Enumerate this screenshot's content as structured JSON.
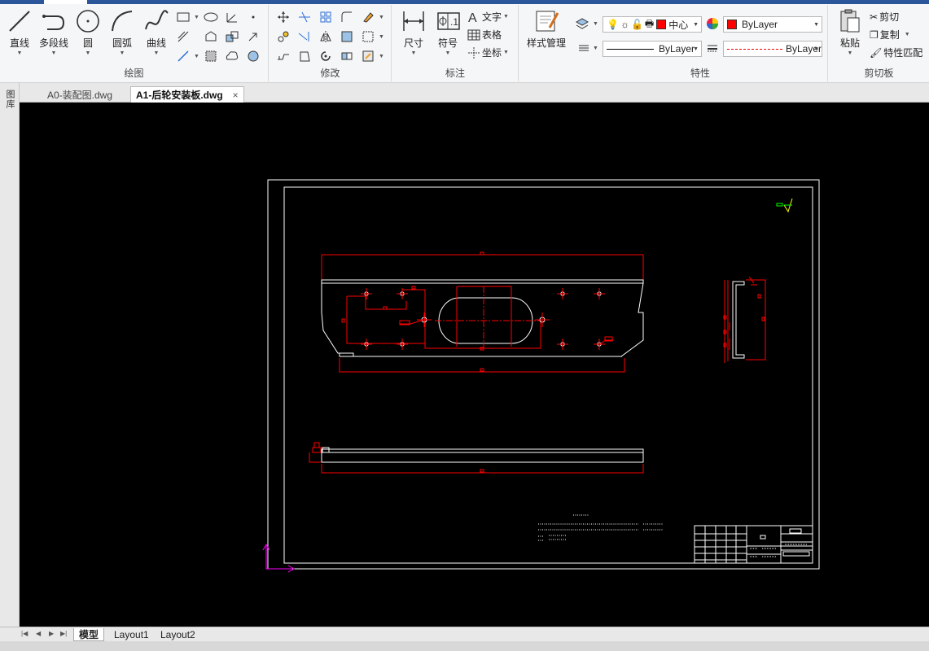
{
  "ribbon": {
    "draw_panel": {
      "title": "绘图",
      "buttons": [
        {
          "label": "直线",
          "icon": "line-icon"
        },
        {
          "label": "多段线",
          "icon": "polyline-icon"
        },
        {
          "label": "圆",
          "icon": "circle-icon"
        },
        {
          "label": "圆弧",
          "icon": "arc-icon"
        },
        {
          "label": "曲线",
          "icon": "spline-icon"
        }
      ]
    },
    "modify_panel": {
      "title": "修改"
    },
    "annotate_panel": {
      "title": "标注",
      "dimension_label": "尺寸",
      "symbol_label": "符号",
      "text_label": "文字",
      "table_label": "表格",
      "coord_label": "坐标"
    },
    "style_panel": {
      "label": "样式管理"
    },
    "properties_panel": {
      "title": "特性",
      "layer_name": "中心",
      "color_value": "ByLayer",
      "linetype_value": "ByLayer",
      "lineweight_value": "ByLayer",
      "color_swatch": "#ff0000"
    },
    "clipboard_panel": {
      "title": "剪切板",
      "paste_label": "粘贴",
      "cut_label": "剪切",
      "copy_label": "复制",
      "match_label": "特性匹配"
    }
  },
  "sidepanel": {
    "label": "图库"
  },
  "tabs": [
    {
      "label": "A0-装配图.dwg",
      "active": false
    },
    {
      "label": "A1-后轮安装板.dwg",
      "active": true,
      "close": "×"
    }
  ],
  "layout_tabs": [
    {
      "label": "模型",
      "active": true
    },
    {
      "label": "Layout1",
      "active": false
    },
    {
      "label": "Layout2",
      "active": false
    }
  ],
  "colors": {
    "canvas_bg": "#000000",
    "drawing_line": "#ffffff",
    "dim_line": "#ff0000",
    "ucs": "#ff00ff",
    "accent": "#2b579a"
  }
}
